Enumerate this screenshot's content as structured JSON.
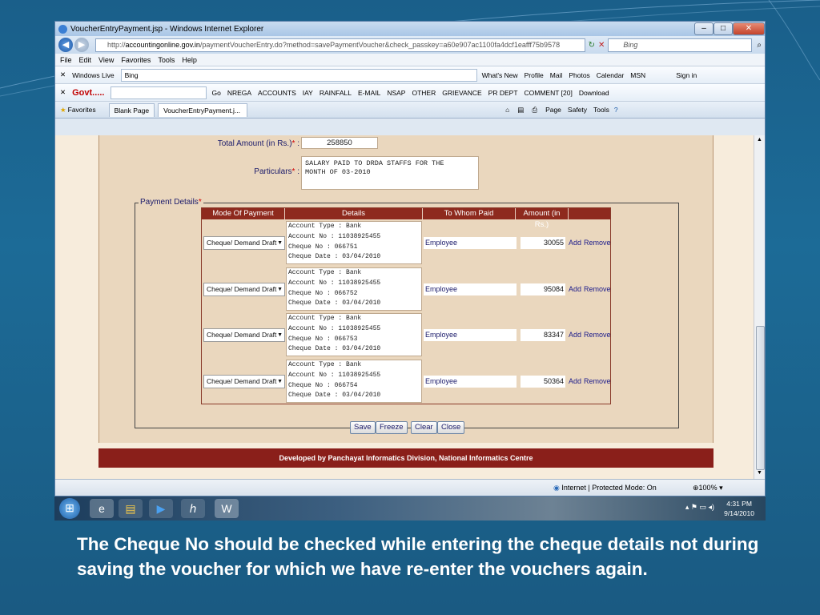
{
  "browser": {
    "title": "VoucherEntryPayment.jsp - Windows Internet Explorer",
    "url_prefix": "http://",
    "url_host": "accountingonline.gov.in",
    "url_path": "/paymentVoucherEntry.do?method=savePaymentVoucher&check_passkey=a60e907ac1100fa4dcf1eafff75b9578",
    "search_placeholder": "Bing",
    "menu": [
      "File",
      "Edit",
      "View",
      "Favorites",
      "Tools",
      "Help"
    ],
    "live_toolbar": {
      "brand": "Windows Live",
      "search_value": "Bing",
      "links": [
        "What's New",
        "Profile",
        "Mail",
        "Photos",
        "Calendar",
        "MSN"
      ],
      "signin": "Sign in"
    },
    "govt_toolbar": {
      "brand": "Govt.....",
      "go": "Go",
      "items": [
        "NREGA",
        "ACCOUNTS",
        "IAY",
        "RAINFALL",
        "E-MAIL",
        "NSAP",
        "OTHER",
        "GRIEVANCE",
        "PR DEPT",
        "COMMENT [20]",
        "Download"
      ]
    },
    "favorites": "Favorites",
    "tabs": [
      "Blank Page",
      "VoucherEntryPayment.j..."
    ],
    "command_bar": [
      "Page",
      "Safety",
      "Tools"
    ],
    "status": "Internet | Protected Mode: On",
    "zoom": "100%"
  },
  "form": {
    "total_amount_label": "Total Amount (in Rs.)",
    "total_amount_value": "258850",
    "particulars_label": "Particulars",
    "particulars_line1": "SALARY PAID TO DRDA STAFFS FOR THE",
    "particulars_line2": "MONTH OF 03-2010",
    "required_mark": "*",
    "label_colon": ":",
    "payment_details_label": "Payment Details",
    "columns": [
      "Mode Of Payment",
      "Details",
      "To Whom Paid",
      "Amount (in Rs.)"
    ],
    "rows": [
      {
        "mode": "Cheque/ Demand Draft",
        "details": "Account Type : Bank\nAccount No : 11038925455\nCheque No : 066751\nCheque Date : 03/04/2010",
        "paid_to": "Employee",
        "amount": "30055"
      },
      {
        "mode": "Cheque/ Demand Draft",
        "details": "Account Type : Bank\nAccount No : 11038925455\nCheque No : 066752\nCheque Date : 03/04/2010",
        "paid_to": "Employee",
        "amount": "95084"
      },
      {
        "mode": "Cheque/ Demand Draft",
        "details": "Account Type : Bank\nAccount No : 11038925455\nCheque No : 066753\nCheque Date : 03/04/2010",
        "paid_to": "Employee",
        "amount": "83347"
      },
      {
        "mode": "Cheque/ Demand Draft",
        "details": "Account Type : Bank\nAccount No : 11038925455\nCheque No : 066754\nCheque Date : 03/04/2010",
        "paid_to": "Employee",
        "amount": "50364"
      }
    ],
    "add_label": "Add",
    "remove_label": "Remove",
    "buttons": {
      "save": "Save",
      "freeze": "Freeze",
      "clear": "Clear",
      "close": "Close"
    },
    "footer": "Developed by Panchayat Informatics Division, National Informatics Centre"
  },
  "taskbar": {
    "time": "4:31 PM",
    "date": "9/14/2010"
  },
  "caption": "The Cheque  No should be checked while entering the cheque details  not during saving the voucher for which we have re-enter the vouchers again.",
  "colors": {
    "header": "#8e2a1e",
    "footer": "#8a1f1a",
    "page_bg": "#ead7be",
    "slide_bg": "#1c6b97"
  }
}
